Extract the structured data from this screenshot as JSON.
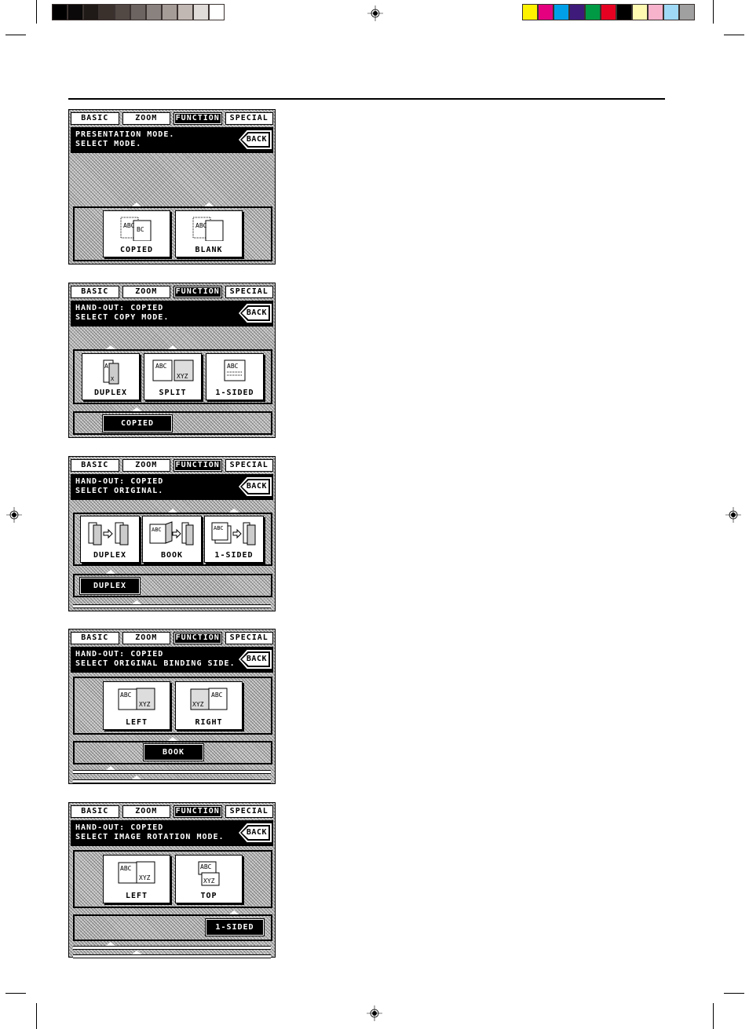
{
  "color_bars": {
    "grayscale": [
      "#000000",
      "#0b0909",
      "#1f1a17",
      "#3a302c",
      "#524844",
      "#6b6461",
      "#8a827e",
      "#a59b97",
      "#c2b8b3",
      "#e0dcd9",
      "#ffffff"
    ],
    "process": [
      "#fff200",
      "#e4007f",
      "#00a0e9",
      "#3e1a7b",
      "#009944",
      "#e60021",
      "#000000",
      "#fff9b1",
      "#f7b2cc",
      "#9fd9f6",
      "#a0a0a0"
    ]
  },
  "panels": [
    {
      "tabs": [
        "BASIC",
        "ZOOM",
        "FUNCTION",
        "SPECIAL"
      ],
      "active_tab": "FUNCTION",
      "message": [
        "PRESENTATION MODE.",
        "SELECT MODE."
      ],
      "back_label": "BACK",
      "options": [
        {
          "label": "COPIED",
          "icon": "copied-sheet-icon"
        },
        {
          "label": "BLANK",
          "icon": "blank-sheet-icon"
        }
      ]
    },
    {
      "tabs": [
        "BASIC",
        "ZOOM",
        "FUNCTION",
        "SPECIAL"
      ],
      "active_tab": "FUNCTION",
      "message": [
        "HAND-OUT: COPIED",
        "SELECT COPY MODE."
      ],
      "back_label": "BACK",
      "options": [
        {
          "label": "DUPLEX",
          "icon": "duplex-icon"
        },
        {
          "label": "SPLIT",
          "icon": "split-icon"
        },
        {
          "label": "1-SIDED",
          "icon": "one-sided-icon"
        }
      ],
      "selected": [
        "COPIED"
      ]
    },
    {
      "tabs": [
        "BASIC",
        "ZOOM",
        "FUNCTION",
        "SPECIAL"
      ],
      "active_tab": "FUNCTION",
      "message": [
        "HAND-OUT: COPIED",
        "SELECT ORIGINAL."
      ],
      "back_label": "BACK",
      "options": [
        {
          "label": "DUPLEX",
          "icon": "duplex-to-duplex-icon"
        },
        {
          "label": "BOOK",
          "icon": "book-to-duplex-icon"
        },
        {
          "label": "1-SIDED",
          "icon": "one-sided-to-duplex-icon"
        }
      ],
      "selected": [
        "DUPLEX"
      ]
    },
    {
      "tabs": [
        "BASIC",
        "ZOOM",
        "FUNCTION",
        "SPECIAL"
      ],
      "active_tab": "FUNCTION",
      "message": [
        "HAND-OUT: COPIED",
        "SELECT ORIGINAL BINDING SIDE."
      ],
      "back_label": "BACK",
      "options": [
        {
          "label": "LEFT",
          "icon": "left-binding-book-icon"
        },
        {
          "label": "RIGHT",
          "icon": "right-binding-book-icon"
        }
      ],
      "selected": [
        "BOOK"
      ]
    },
    {
      "tabs": [
        "BASIC",
        "ZOOM",
        "FUNCTION",
        "SPECIAL"
      ],
      "active_tab": "FUNCTION",
      "message": [
        "HAND-OUT: COPIED",
        "SELECT IMAGE ROTATION MODE."
      ],
      "back_label": "BACK",
      "options": [
        {
          "label": "LEFT",
          "icon": "left-rotation-icon"
        },
        {
          "label": "TOP",
          "icon": "top-rotation-icon"
        }
      ],
      "selected": [
        "1-SIDED"
      ]
    }
  ]
}
